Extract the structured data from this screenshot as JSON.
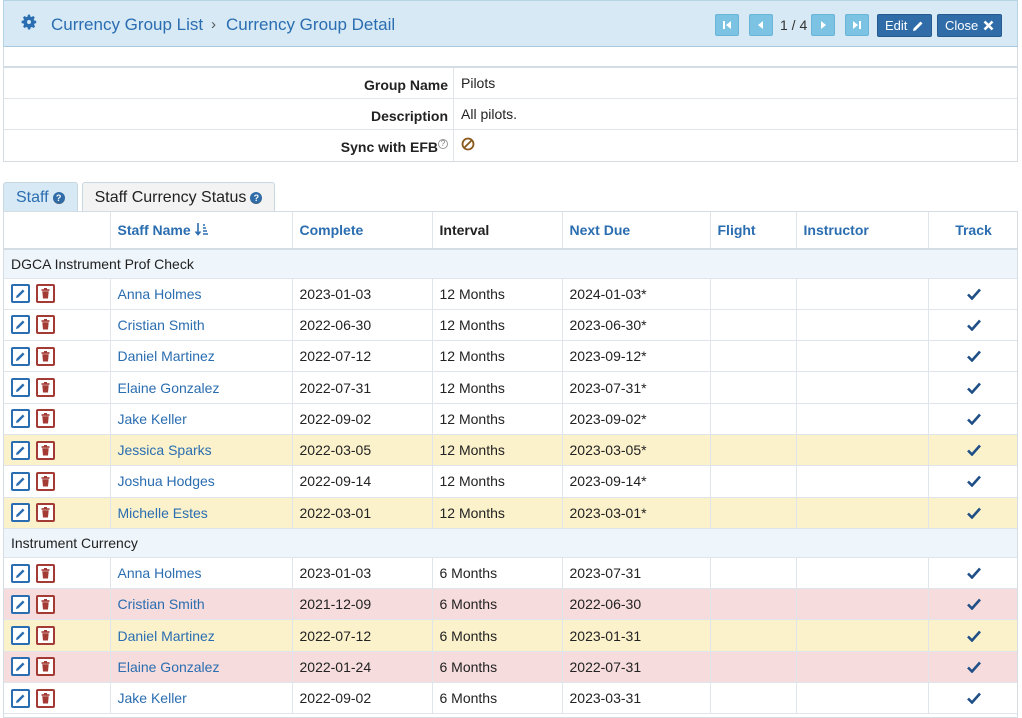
{
  "header": {
    "breadcrumb_root": "Currency Group List",
    "breadcrumb_sep": "›",
    "breadcrumb_current": "Currency Group Detail",
    "page_indicator": "1 / 4",
    "edit_label": "Edit",
    "close_label": "Close"
  },
  "detail": {
    "rows": [
      {
        "label": "Group Name",
        "value": "Pilots"
      },
      {
        "label": "Description",
        "value": "All pilots."
      },
      {
        "label": "Sync with EFB",
        "value": ""
      }
    ]
  },
  "tabs": [
    {
      "label": "Staff",
      "active": true
    },
    {
      "label": "Staff Currency Status",
      "active": false
    }
  ],
  "grid": {
    "columns": [
      "",
      "Staff Name",
      "Complete",
      "Interval",
      "Next Due",
      "Flight",
      "Instructor",
      "Track"
    ],
    "groups": [
      {
        "name": "DGCA Instrument Prof Check",
        "rows": [
          {
            "name": "Anna Holmes",
            "complete": "2023-01-03",
            "interval": "12 Months",
            "next_due": "2024-01-03*",
            "status": "ok"
          },
          {
            "name": "Cristian Smith",
            "complete": "2022-06-30",
            "interval": "12 Months",
            "next_due": "2023-06-30*",
            "status": "ok"
          },
          {
            "name": "Daniel Martinez",
            "complete": "2022-07-12",
            "interval": "12 Months",
            "next_due": "2023-09-12*",
            "status": "ok"
          },
          {
            "name": "Elaine Gonzalez",
            "complete": "2022-07-31",
            "interval": "12 Months",
            "next_due": "2023-07-31*",
            "status": "ok"
          },
          {
            "name": "Jake Keller",
            "complete": "2022-09-02",
            "interval": "12 Months",
            "next_due": "2023-09-02*",
            "status": "ok"
          },
          {
            "name": "Jessica Sparks",
            "complete": "2022-03-05",
            "interval": "12 Months",
            "next_due": "2023-03-05*",
            "status": "warn"
          },
          {
            "name": "Joshua Hodges",
            "complete": "2022-09-14",
            "interval": "12 Months",
            "next_due": "2023-09-14*",
            "status": "ok"
          },
          {
            "name": "Michelle Estes",
            "complete": "2022-03-01",
            "interval": "12 Months",
            "next_due": "2023-03-01*",
            "status": "warn"
          }
        ]
      },
      {
        "name": "Instrument Currency",
        "rows": [
          {
            "name": "Anna Holmes",
            "complete": "2023-01-03",
            "interval": "6 Months",
            "next_due": "2023-07-31",
            "status": "ok"
          },
          {
            "name": "Cristian Smith",
            "complete": "2021-12-09",
            "interval": "6 Months",
            "next_due": "2022-06-30",
            "status": "over"
          },
          {
            "name": "Daniel Martinez",
            "complete": "2022-07-12",
            "interval": "6 Months",
            "next_due": "2023-01-31",
            "status": "warn"
          },
          {
            "name": "Elaine Gonzalez",
            "complete": "2022-01-24",
            "interval": "6 Months",
            "next_due": "2022-07-31",
            "status": "over"
          },
          {
            "name": "Jake Keller",
            "complete": "2022-09-02",
            "interval": "6 Months",
            "next_due": "2023-03-31",
            "status": "ok"
          }
        ]
      }
    ]
  },
  "colors": {
    "link": "#2a6db0",
    "header_bg": "#d6e9f5",
    "warn_row": "#fbf2cc",
    "overdue_row": "#f6dcdc"
  }
}
